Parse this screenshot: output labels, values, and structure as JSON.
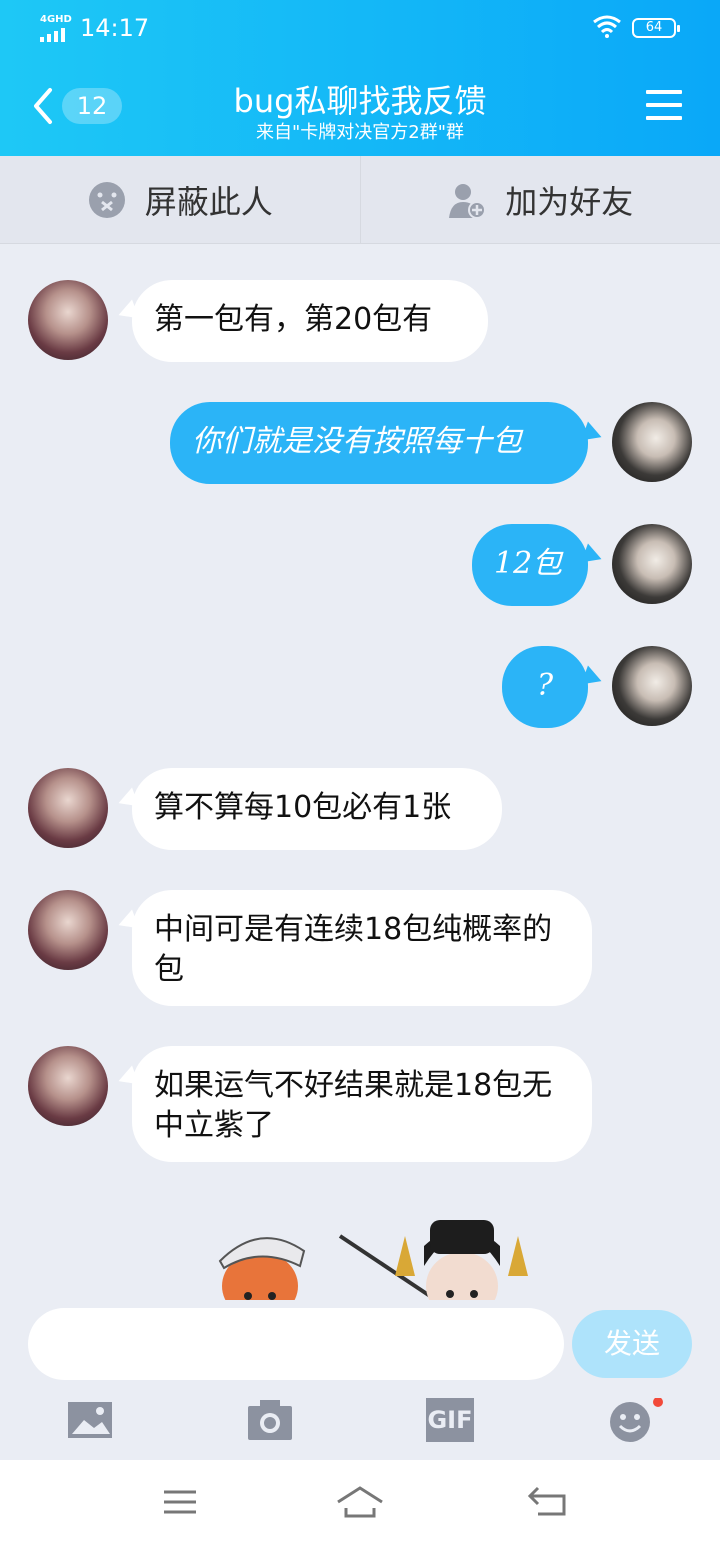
{
  "status_bar": {
    "network": "4GHD",
    "time": "14:17",
    "battery": "64"
  },
  "header": {
    "unread_count": "12",
    "title": "bug私聊找我反馈",
    "subtitle": "来自\"卡牌对决官方2群\"群"
  },
  "actions": [
    {
      "label": "屏蔽此人",
      "icon": "block-user-icon"
    },
    {
      "label": "加为好友",
      "icon": "add-friend-icon"
    }
  ],
  "messages": [
    {
      "side": "in",
      "text": "第一包有，第20包有"
    },
    {
      "side": "out",
      "text": "你们就是没有按照每十包"
    },
    {
      "side": "out",
      "text": "12包"
    },
    {
      "side": "out",
      "text": "?"
    },
    {
      "side": "in",
      "text": "算不算每10包必有1张"
    },
    {
      "side": "in",
      "text": "中间可是有连续18包纯概率的包"
    },
    {
      "side": "in",
      "text": "如果运气不好结果就是18包无中立紫了"
    }
  ],
  "composer": {
    "input_value": "",
    "send_label": "发送"
  },
  "toolbar": [
    "image-icon",
    "camera-icon",
    "gif-icon",
    "emoji-icon"
  ],
  "toolbar_gif_label": "GIF",
  "colors": {
    "header_start": "#1ec8f6",
    "header_end": "#0aa8f8",
    "outgoing_bubble": "#2bb4f7",
    "send_disabled": "#aee3fb",
    "background": "#eaedf4"
  }
}
